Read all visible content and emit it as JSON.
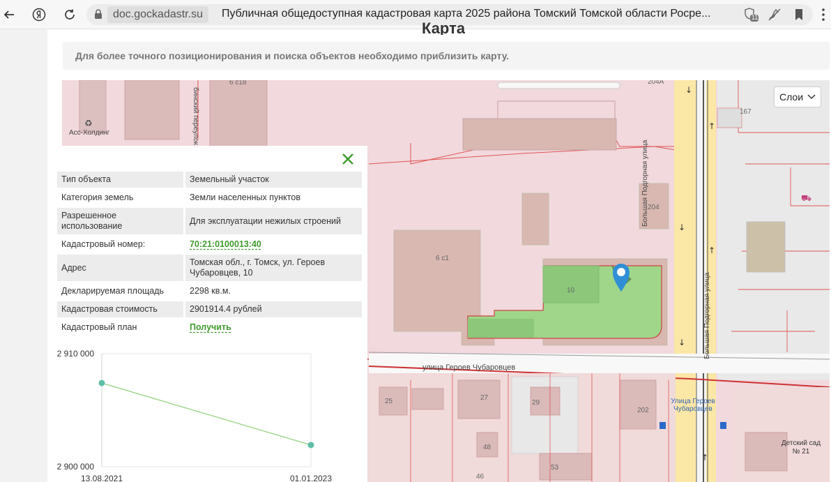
{
  "browser": {
    "domain": "doc.gockadastr.su",
    "tab_title": "Публичная общедоступная кадастровая карта 2025 района Томский Томской области Росре...",
    "shield_count": "11"
  },
  "page": {
    "heading": "Карта",
    "notice": "Для более точного позиционирования и поиска объектов необходимо приблизить карту."
  },
  "map": {
    "layers_label": "Слои",
    "labels": {
      "holding": "Асс-Холдинг",
      "b6c18": "6 с18",
      "b204a": "204А",
      "b167": "167",
      "b204": "204",
      "b6c1": "6 с1",
      "b10": "10",
      "b25": "25",
      "b27": "27",
      "b29": "29",
      "b202": "202",
      "b48": "48",
      "b53": "53",
      "b46": "46",
      "street_lane": "бинский переулок",
      "street_podgornaya_1": "Большая Подгорная улица",
      "street_podgornaya_2": "Большая Подгорная улица",
      "street_geroev": "улица Героев Чубаровцев",
      "stop_name": "Улица Героев Чубаровцев",
      "kindergarten": "Детский сад № 21"
    }
  },
  "info": {
    "rows": [
      {
        "key": "Тип объекта",
        "value": "Земельный участок"
      },
      {
        "key": "Категория земель",
        "value": "Земли населенных пунктов"
      },
      {
        "key": "Разрешенное использование",
        "value": "Для эксплуатации нежилых строений"
      },
      {
        "key": "Кадастровый номер:",
        "value": "70:21:0100013:40"
      },
      {
        "key": "Адрес",
        "value": "Томская обл., г. Томск, ул. Героев Чубаровцев, 10"
      },
      {
        "key": "Декларируемая площадь",
        "value": "2298 кв.м."
      },
      {
        "key": "Кадастровая стоимость",
        "value": "2901914.4 рублей"
      },
      {
        "key": "Кадастровый план",
        "value": "Получить"
      }
    ]
  },
  "chart_data": {
    "type": "line",
    "x": [
      "13.08.2021",
      "01.01.2023"
    ],
    "series": [
      {
        "values": [
          2907400,
          2901914.4
        ],
        "color": "#5dbfa8"
      }
    ],
    "ylim": [
      2900000,
      2910000
    ],
    "ytick_labels": [
      "2 910 000",
      "2 900 000"
    ],
    "yticks": [
      2910000,
      2900000
    ],
    "grid": true
  },
  "colors": {
    "accent_green": "#3e9b2c",
    "parcel_fill": "#9fd68a",
    "marker": "#2f8fd6"
  }
}
